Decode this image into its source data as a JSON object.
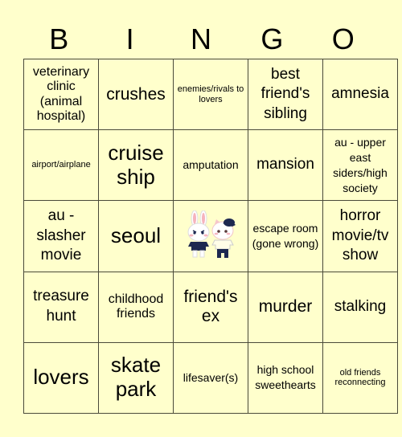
{
  "header": [
    "B",
    "I",
    "N",
    "G",
    "O"
  ],
  "board": {
    "rows": [
      [
        "veterinary clinic (animal hospital)",
        "crushes",
        "enemies/rivals to lovers",
        "best friend's sibling",
        "amnesia"
      ],
      [
        "airport/airplane",
        "cruise ship",
        "amputation",
        "mansion",
        "au - upper east siders/high society"
      ],
      [
        "au - slasher movie",
        "seoul",
        "",
        "escape room (gone wrong)",
        "horror movie/tv show"
      ],
      [
        "treasure hunt",
        "childhood friends",
        "friend's ex",
        "murder",
        "stalking"
      ],
      [
        "lovers",
        "skate park",
        "lifesaver(s)",
        "high school sweethearts",
        "old friends reconnecting"
      ]
    ],
    "free_space_image": "bunny-and-cat-characters"
  },
  "colors": {
    "background": "#ffffcc",
    "grid_line": "#4a4a3a",
    "text": "#000000"
  }
}
